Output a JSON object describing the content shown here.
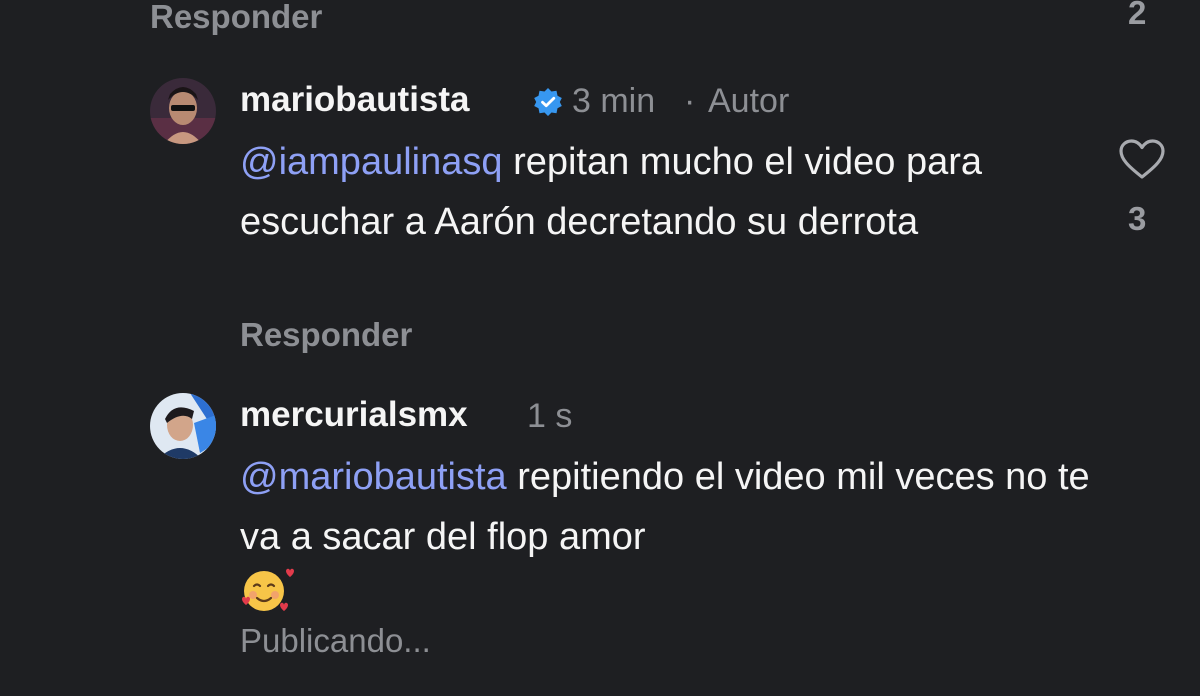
{
  "top": {
    "reply_label": "Responder",
    "like_count": "2"
  },
  "comment1": {
    "username": "mariobautista",
    "time": "3 min",
    "separator": "·",
    "author_tag": "Autor",
    "mention": "@iampaulinasq",
    "text": "repitan mucho el video para escuchar a Aarón decretando su derrota",
    "reply_label": "Responder",
    "like_count": "3"
  },
  "comment2": {
    "username": "mercurialsmx",
    "time": "1 s",
    "mention": "@mariobautista",
    "text": "repitiendo el video mil veces no te va a sacar del flop amor",
    "emoji": "🥰",
    "status": "Publicando..."
  },
  "colors": {
    "background": "#1e1f22",
    "mention": "#8ea0f5",
    "muted": "#8d8f94",
    "verified": "#3797f0"
  }
}
